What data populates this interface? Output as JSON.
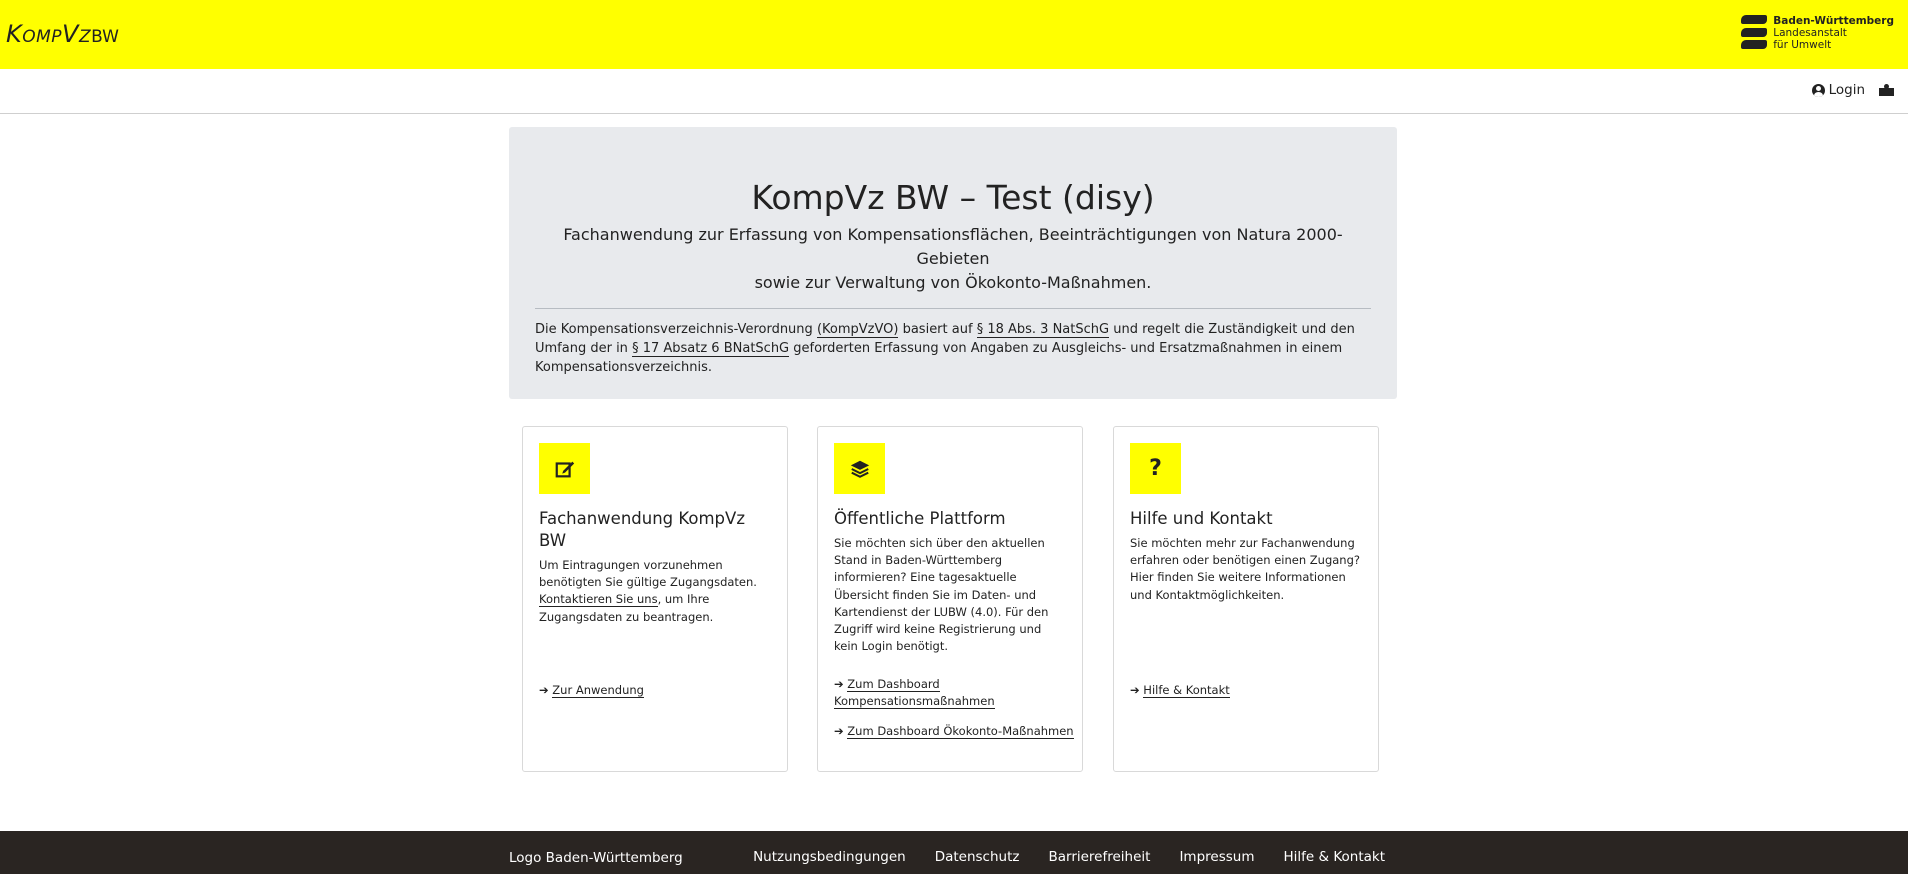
{
  "header": {
    "brand_main": "KompVz",
    "brand_sub": "BW",
    "org_line1": "Baden-Württemberg",
    "org_line2": "Landesanstalt",
    "org_line3": "für Umwelt"
  },
  "nav": {
    "login_label": "Login",
    "icons": [
      "user-circle-icon",
      "library-icon"
    ]
  },
  "hero": {
    "title": "KompVz BW – Test (disy)",
    "lead_line1": "Fachanwendung zur Erfassung von Kompensationsflächen, Beeinträchtigungen von Natura 2000-Gebieten",
    "lead_line2": "sowie zur Verwaltung von Ökokonto-Maßnahmen.",
    "desc_part1": "Die Kompensationsverzeichnis-Verordnung ",
    "link_kompvzvo": "(KompVzVO)",
    "desc_part2": " basiert auf ",
    "link_natschg": "§ 18 Abs. 3 NatSchG",
    "desc_part3": " und regelt die Zuständigkeit und den Umfang der in ",
    "link_bnatschg": "§ 17 Absatz 6 BNatSchG",
    "desc_part4": " geforderten Erfassung von Angaben zu Ausgleichs- und Ersatzmaßnahmen in einem Kompensationsverzeichnis."
  },
  "cards": [
    {
      "icon": "edit-icon",
      "title": "Fachanwendung KompVz BW",
      "text_part1": "Um Eintragungen vorzunehmen benötigten Sie gültige Zugangsdaten. ",
      "inline_link": "Kontaktieren Sie uns",
      "text_part2": ", um Ihre Zugangsdaten zu beantragen.",
      "link1": "Zur Anwendung"
    },
    {
      "icon": "layers-icon",
      "title": "Öffentliche Plattform",
      "text": "Sie möchten sich über den aktuellen Stand in Baden-Württemberg informieren? Eine tagesaktuelle Übersicht finden Sie im Daten- und Kartendienst der LUBW (4.0). Für den Zugriff wird keine Registrierung und kein Login benötigt.",
      "link1": "Zum Dashboard Kompensationsmaßnahmen",
      "link2": "Zum Dashboard Ökokonto-Maßnahmen"
    },
    {
      "icon": "question-icon",
      "title": "Hilfe und Kontakt",
      "text": "Sie möchten mehr zur Fachanwendung erfahren oder benötigen einen Zugang? Hier finden Sie weitere Informationen und Kontaktmöglichkeiten.",
      "link1": "Hilfe & Kontakt"
    }
  ],
  "footer": {
    "logo_text": "Logo Baden-Württemberg",
    "links": [
      "Nutzungsbedingungen",
      "Datenschutz",
      "Barrierefreiheit",
      "Impressum",
      "Hilfe & Kontakt"
    ]
  },
  "colors": {
    "accent_yellow": "#ffff00",
    "hero_bg": "#e8eaed",
    "footer_bg": "#2a2522"
  }
}
